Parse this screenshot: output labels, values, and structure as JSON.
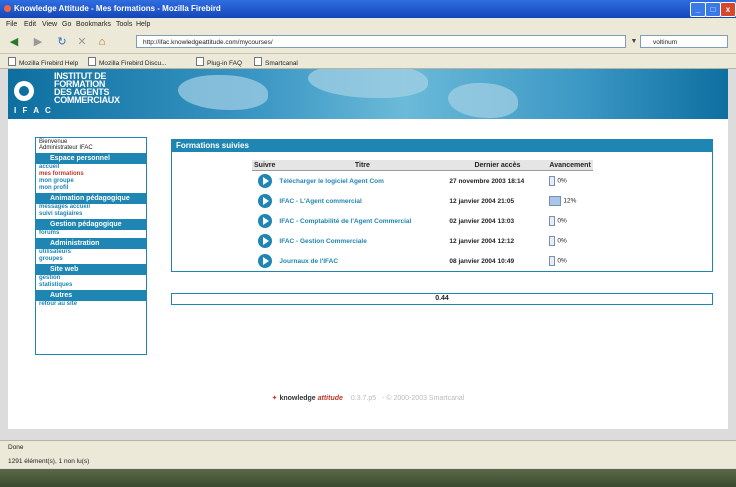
{
  "window": {
    "title": "Knowledge Attitude - Mes formations - Mozilla Firebird"
  },
  "menu": [
    "File",
    "Edit",
    "View",
    "Go",
    "Bookmarks",
    "Tools",
    "Help"
  ],
  "toolbar": {
    "url": "http://ifac.knowledgeattitude.com/mycourses/",
    "search_value": "voltinum"
  },
  "bookmarks": [
    "Mozilla Firebird Help",
    "Mozilla Firebird Discu...",
    "Plug-in FAQ",
    "Smartcanal"
  ],
  "banner": {
    "line1": "INSTITUT DE",
    "line2": "FORMATION",
    "line3": "DES AGENTS",
    "line4": "COMMERCIAUX",
    "ifac": "I F A C"
  },
  "sidebar": {
    "welcome1": "Bienvenue",
    "welcome2": "Administrateur IFAC",
    "sections": [
      {
        "title": "Espace personnel",
        "links": [
          "accueil",
          "mes formations",
          "mon groupe",
          "mon profil"
        ]
      },
      {
        "title": "Animation pédagogique",
        "links": [
          "messages accueil",
          "suivi stagiaires"
        ]
      },
      {
        "title": "Gestion pédagogique",
        "links": [
          "forums"
        ]
      },
      {
        "title": "Administration",
        "links": [
          "utilisateurs",
          "groupes"
        ]
      },
      {
        "title": "Site web",
        "links": [
          "gestion",
          "statistiques"
        ]
      },
      {
        "title": "Autres",
        "links": [
          "retour au site"
        ]
      }
    ]
  },
  "panel": {
    "title": "Formations suivies",
    "headers": {
      "suivre": "Suivre",
      "titre": "Titre",
      "acces": "Dernier accès",
      "avancement": "Avancement"
    },
    "rows": [
      {
        "title": "Télécharger le logiciel Agent Com",
        "date": "27 novembre 2003 18:14",
        "progress": "0%"
      },
      {
        "title": "IFAC - L'Agent commercial",
        "date": "12 janvier 2004 21:05",
        "progress": "12%"
      },
      {
        "title": "IFAC - Comptabilité de l'Agent Commercial",
        "date": "02 janvier 2004 13:03",
        "progress": "0%"
      },
      {
        "title": "IFAC - Gestion Commerciale",
        "date": "12 janvier 2004 12:12",
        "progress": "0%"
      },
      {
        "title": "Journaux de l'IFAC",
        "date": "08 janvier 2004 10:49",
        "progress": "0%"
      }
    ]
  },
  "score": "0.44",
  "footer": {
    "brand": "knowledge",
    "brand2": "attitude",
    "version": "0.3.7.p5",
    "copyright": "- © 2000-2003 Smartcanal"
  },
  "status": {
    "line1": "Done",
    "line2": "1291 élément(s), 1 non lu(s)"
  }
}
